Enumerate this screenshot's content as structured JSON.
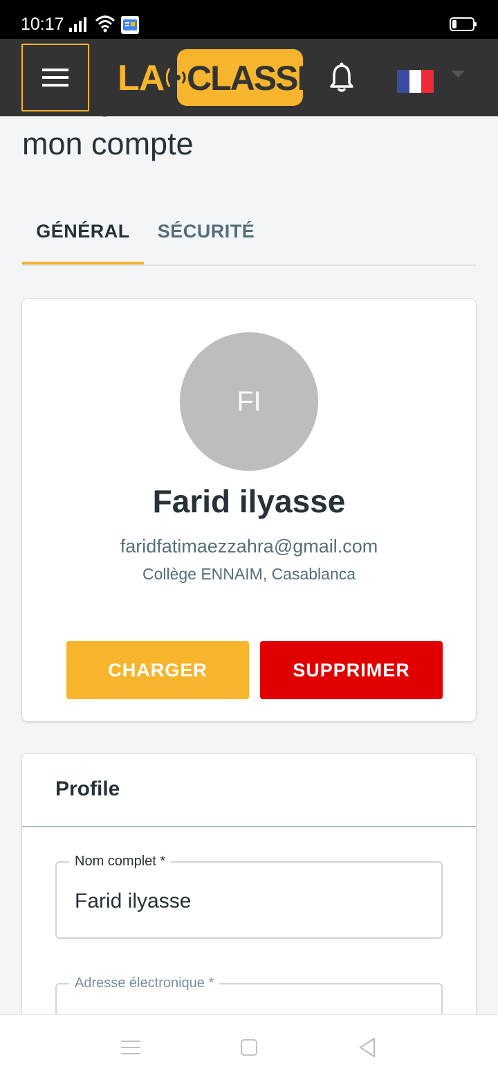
{
  "status_bar": {
    "time": "10:17"
  },
  "app_bar": {
    "logo_left": "LA",
    "logo_right": "CLASSE",
    "language_flag": "france-flag"
  },
  "page": {
    "title": "Changer les informations de mon compte"
  },
  "tabs": [
    {
      "label": "GÉNÉRAL",
      "active": true
    },
    {
      "label": "SÉCURITÉ",
      "active": false
    }
  ],
  "user_card": {
    "initials": "FI",
    "name": "Farid ilyasse",
    "email": "faridfatimaezzahra@gmail.com",
    "school": "Collège ENNAIM, Casablanca",
    "upload_button": "CHARGER",
    "delete_button": "SUPPRIMER"
  },
  "profile_card": {
    "title": "Profile",
    "fields": [
      {
        "label": "Nom complet *",
        "value": "Farid ilyasse"
      },
      {
        "label": "Adresse électronique *",
        "value": ""
      }
    ]
  },
  "colors": {
    "accent": "#f6b52d",
    "danger": "#e00000",
    "app_bar": "#333333"
  }
}
